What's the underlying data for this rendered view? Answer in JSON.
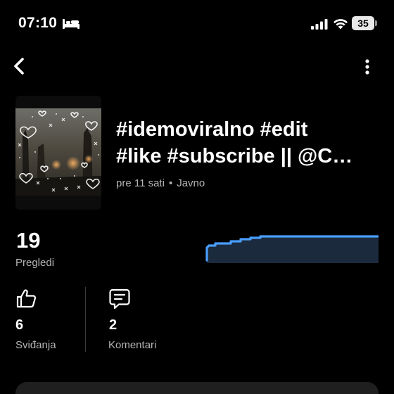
{
  "status_bar": {
    "time": "07:10",
    "battery": "35",
    "icons": [
      "bed-icon",
      "signal-icon",
      "wifi-icon",
      "battery-icon"
    ]
  },
  "nav": {
    "back_icon": "chevron-left-icon",
    "more_icon": "more-vertical-icon"
  },
  "video": {
    "title_line1": "#idemoviralno #edit",
    "title_line2": "#like #subscribe || @C…",
    "posted": "pre 11 sati",
    "separator": "•",
    "visibility": "Javno"
  },
  "views": {
    "count": "19",
    "label": "Pregledi",
    "chart_color": "#4a9eff",
    "chart_fill": "#1c2a3d"
  },
  "stats": {
    "likes": {
      "count": "6",
      "label": "Sviđanja",
      "icon": "thumbs-up-icon"
    },
    "comments": {
      "count": "2",
      "label": "Komentari",
      "icon": "comment-icon"
    }
  }
}
